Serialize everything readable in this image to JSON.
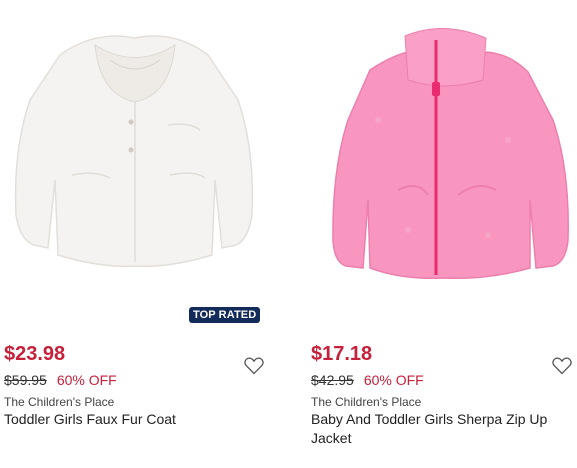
{
  "products": [
    {
      "badge": "TOP RATED",
      "price": "$23.98",
      "original_price": "$59.95",
      "discount": "60% OFF",
      "brand": "The Children's Place",
      "name": "Toddler Girls Faux Fur Coat",
      "image_color": "#f3f1ee",
      "icon": "heart-outline-icon"
    },
    {
      "price": "$17.18",
      "original_price": "$42.95",
      "discount": "60% OFF",
      "brand": "The Children's Place",
      "name": "Baby And Toddler Girls Sherpa Zip Up Jacket",
      "image_color": "#f79ac2",
      "icon": "heart-outline-icon"
    }
  ]
}
